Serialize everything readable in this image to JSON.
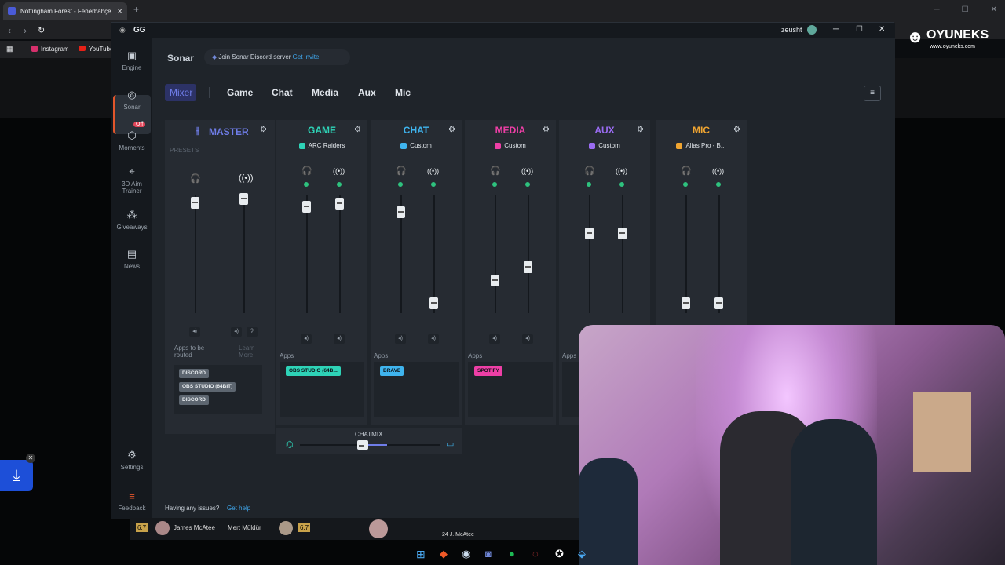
{
  "browser": {
    "tab_title": "Nottingham Forest - Fenerbahçe",
    "tab_close": "✕",
    "new_tab": "+",
    "bookmarks": [
      "Instagram",
      "YouTube"
    ]
  },
  "overlay_brand": {
    "name": "OYUNEKS",
    "url": "www.oyuneks.com"
  },
  "app": {
    "title": "GG",
    "user": "zeusht",
    "header": {
      "section": "Sonar",
      "discord_text": "Join Sonar Discord server",
      "discord_link": "Get invite"
    },
    "sidebar": [
      {
        "label": "Engine",
        "icon": "chip-icon"
      },
      {
        "label": "Sonar",
        "icon": "sonar-icon"
      },
      {
        "label": "Moments",
        "icon": "moments-icon",
        "badge": "Off"
      },
      {
        "label": "3D Aim Trainer",
        "icon": "aim-icon"
      },
      {
        "label": "Giveaways",
        "icon": "gift-icon"
      },
      {
        "label": "News",
        "icon": "news-icon"
      },
      {
        "label": "Settings",
        "icon": "gear-icon"
      },
      {
        "label": "Feedback",
        "icon": "feedback-icon"
      }
    ],
    "tabs": [
      "Mixer",
      "Game",
      "Chat",
      "Media",
      "Aux",
      "Mic"
    ],
    "master": {
      "title": "MASTER",
      "presets": "PRESETS",
      "apps_routed": "Apps to be routed",
      "learn_more": "Learn More",
      "chips": [
        "DISCORD",
        "OBS STUDIO (64BIT)",
        "DISCORD"
      ]
    },
    "channels": [
      {
        "name": "GAME",
        "device": "ARC Raiders",
        "color": "#2ed3b7",
        "apps_label": "Apps",
        "app_chip": "OBS STUDIO (64B...",
        "chip_color": "#2ed3b7",
        "levels": [
          0.95,
          0.98
        ]
      },
      {
        "name": "CHAT",
        "device": "Custom",
        "color": "#3fb4ee",
        "apps_label": "Apps",
        "app_chip": "BRAVE",
        "chip_color": "#3fb4ee",
        "levels": [
          0.9,
          0.04
        ]
      },
      {
        "name": "MEDIA",
        "device": "Custom",
        "color": "#ee3fa6",
        "apps_label": "Apps",
        "app_chip": "SPOTIFY",
        "chip_color": "#ee3fa6",
        "levels": [
          0.25,
          0.38
        ]
      },
      {
        "name": "AUX",
        "device": "Custom",
        "color": "#9a6cf2",
        "apps_label": "Apps",
        "app_chip": "",
        "chip_color": "#9a6cf2",
        "levels": [
          0.7,
          0.7
        ]
      },
      {
        "name": "MIC",
        "device": "Alias Pro - B...",
        "color": "#f0a531",
        "apps_label": "",
        "app_chip": "",
        "chip_color": "#f0a531",
        "levels": [
          0.04,
          0.04
        ]
      }
    ],
    "chatmix": {
      "label": "CHATMIX",
      "value": 0.45
    },
    "footer": {
      "text": "Having any issues?",
      "link": "Get help"
    }
  },
  "stream_overlay": {
    "players": [
      "James McAtee",
      "Mert Müldür"
    ],
    "ratings": [
      "6.7",
      "6.7"
    ],
    "sub": "24 J. McAtee"
  }
}
